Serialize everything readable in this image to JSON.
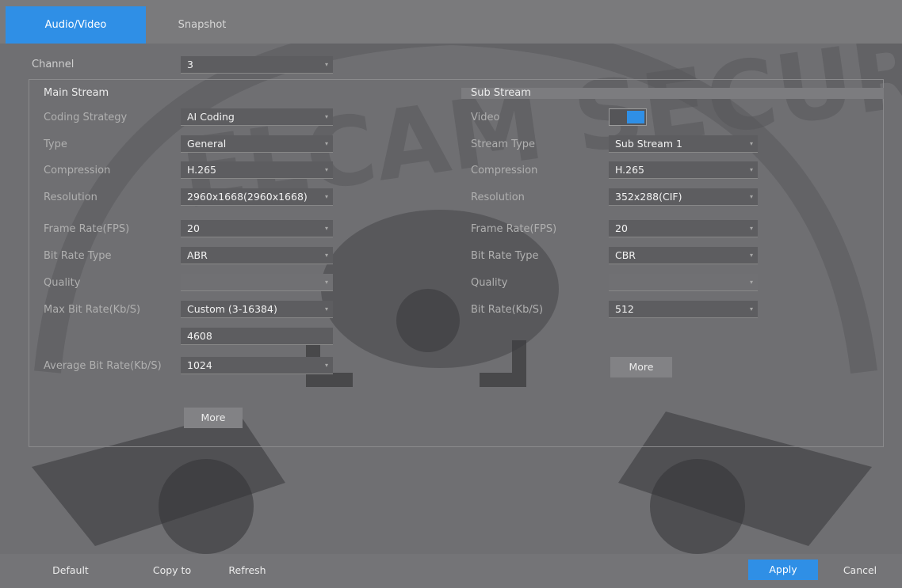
{
  "tabs": [
    {
      "label": "Audio/Video",
      "active": true
    },
    {
      "label": "Snapshot",
      "active": false
    }
  ],
  "channel": {
    "label": "Channel",
    "value": "3"
  },
  "main_stream": {
    "title": "Main Stream",
    "coding_strategy": {
      "label": "Coding Strategy",
      "value": "AI Coding"
    },
    "type": {
      "label": "Type",
      "value": "General"
    },
    "compression": {
      "label": "Compression",
      "value": "H.265"
    },
    "resolution": {
      "label": "Resolution",
      "value": "2960x1668(2960x1668)"
    },
    "frame_rate": {
      "label": "Frame Rate(FPS)",
      "value": "20"
    },
    "bit_rate_type": {
      "label": "Bit Rate Type",
      "value": "ABR"
    },
    "quality": {
      "label": "Quality",
      "value": ""
    },
    "max_bit_rate": {
      "label": "Max Bit Rate(Kb/S)",
      "value": "Custom (3-16384)",
      "custom_value": "4608"
    },
    "average_bit_rate": {
      "label": "Average Bit Rate(Kb/S)",
      "value": "1024"
    },
    "more_label": "More"
  },
  "sub_stream": {
    "title": "Sub Stream",
    "video": {
      "label": "Video",
      "enabled": true
    },
    "stream_type": {
      "label": "Stream Type",
      "value": "Sub Stream 1"
    },
    "compression": {
      "label": "Compression",
      "value": "H.265"
    },
    "resolution": {
      "label": "Resolution",
      "value": "352x288(CIF)"
    },
    "frame_rate": {
      "label": "Frame Rate(FPS)",
      "value": "20"
    },
    "bit_rate_type": {
      "label": "Bit Rate Type",
      "value": "CBR"
    },
    "quality": {
      "label": "Quality",
      "value": ""
    },
    "bit_rate": {
      "label": "Bit Rate(Kb/S)",
      "value": "512"
    },
    "more_label": "More"
  },
  "footer": {
    "default_label": "Default",
    "copy_to_label": "Copy to",
    "refresh_label": "Refresh",
    "apply_label": "Apply",
    "cancel_label": "Cancel"
  },
  "watermark": {
    "text": "ELCAM SECURITY"
  },
  "colors": {
    "accent": "#2f8fe6",
    "background": "#6f6f72"
  }
}
